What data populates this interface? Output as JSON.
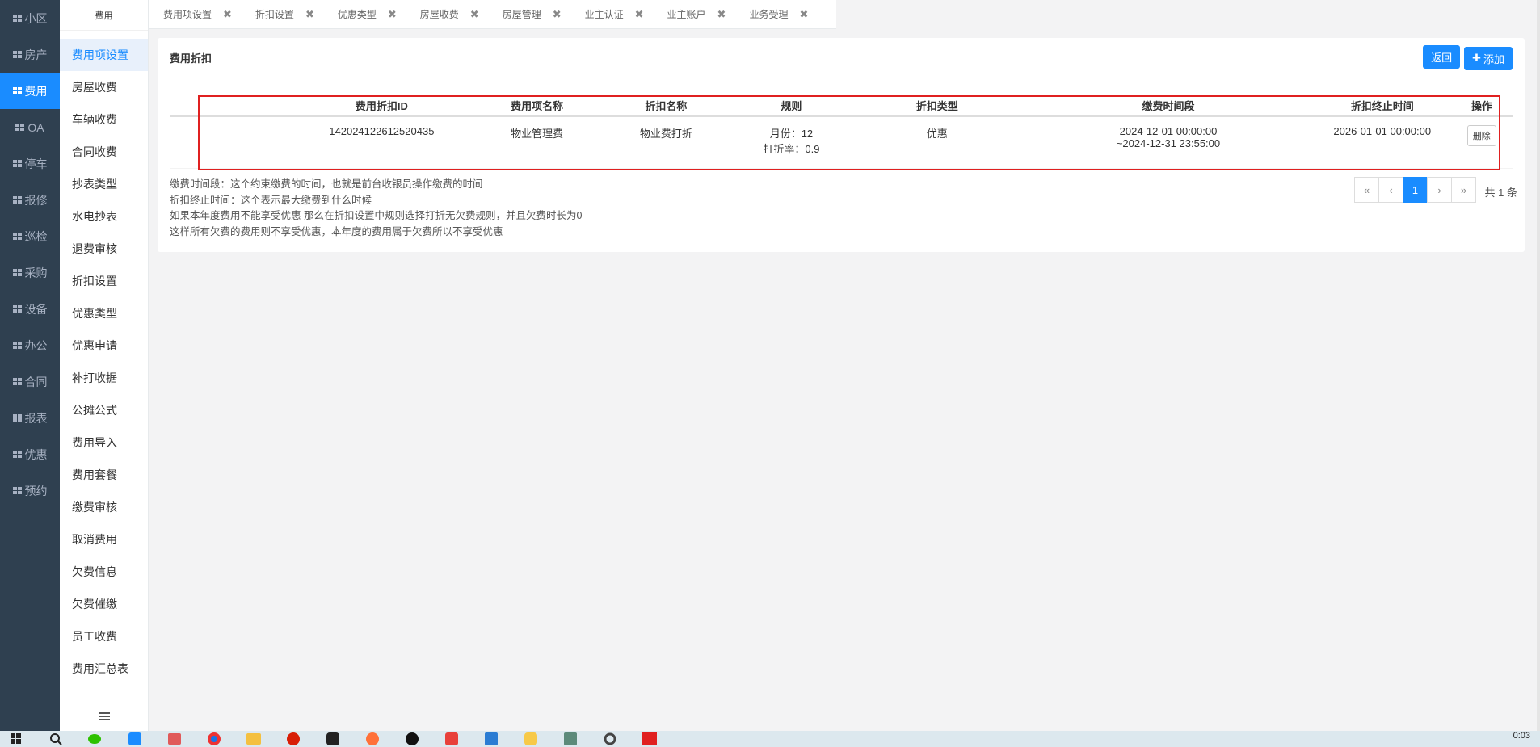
{
  "main_nav": [
    {
      "label": "小区",
      "active": false
    },
    {
      "label": "房产",
      "active": false
    },
    {
      "label": "费用",
      "active": true
    },
    {
      "label": "OA",
      "active": false
    },
    {
      "label": "停车",
      "active": false
    },
    {
      "label": "报修",
      "active": false
    },
    {
      "label": "巡检",
      "active": false
    },
    {
      "label": "采购",
      "active": false
    },
    {
      "label": "设备",
      "active": false
    },
    {
      "label": "办公",
      "active": false
    },
    {
      "label": "合同",
      "active": false
    },
    {
      "label": "报表",
      "active": false
    },
    {
      "label": "优惠",
      "active": false
    },
    {
      "label": "预约",
      "active": false
    }
  ],
  "sub_nav": {
    "title": "费用",
    "items": [
      "费用项设置",
      "房屋收费",
      "车辆收费",
      "合同收费",
      "抄表类型",
      "水电抄表",
      "退费审核",
      "折扣设置",
      "优惠类型",
      "优惠申请",
      "补打收据",
      "公摊公式",
      "费用导入",
      "费用套餐",
      "缴费审核",
      "取消费用",
      "欠费信息",
      "欠费催缴",
      "员工收费",
      "费用汇总表"
    ],
    "active_index": 0
  },
  "tabs": [
    "费用项设置",
    "折扣设置",
    "优惠类型",
    "房屋收费",
    "房屋管理",
    "业主认证",
    "业主账户",
    "业务受理"
  ],
  "panel": {
    "title": "费用折扣",
    "back_label": "返回",
    "add_label": "添加"
  },
  "table": {
    "columns": [
      "费用折扣ID",
      "费用项名称",
      "折扣名称",
      "规则",
      "折扣类型",
      "缴费时间段",
      "折扣终止时间",
      "操作"
    ],
    "rows": [
      {
        "id": "142024122612520435",
        "fee_name": "物业管理费",
        "discount_name": "物业费打折",
        "rule_line1": "月份：12",
        "rule_line2": "打折率：0.9",
        "discount_type": "优惠",
        "period_line1": "2024-12-01 00:00:00",
        "period_line2": "~2024-12-31 23:55:00",
        "end_time": "2026-01-01 00:00:00",
        "action_label": "删除"
      }
    ]
  },
  "notes": [
    "缴费时间段：这个约束缴费的时间，也就是前台收银员操作缴费的时间",
    "折扣终止时间：这个表示最大缴费到什么时候",
    "如果本年度费用不能享受优惠 那么在折扣设置中规则选择打折无欠费规则，并且欠费时长为0",
    "这样所有欠费的费用则不享受优惠，本年度的费用属于欠费所以不享受优惠"
  ],
  "pagination": {
    "first": "«",
    "prev": "‹",
    "current": "1",
    "next": "›",
    "last": "»",
    "total_text": "共 1 条"
  },
  "taskbar": {
    "clock": "0:03",
    "icons": [
      "windows-icon",
      "search-icon",
      "wechat-icon",
      "app-store-icon",
      "eraser-icon",
      "chrome-icon",
      "folder-icon",
      "netease-music-icon",
      "capture-icon",
      "firefox-icon",
      "x-icon",
      "wps-icon",
      "vscode-icon",
      "python-icon",
      "terminal-icon",
      "settings-icon",
      "hc-icon"
    ]
  },
  "colors": {
    "sidebar_bg": "#2f4050",
    "accent": "#1a8cff",
    "highlight_border": "#e02020"
  }
}
